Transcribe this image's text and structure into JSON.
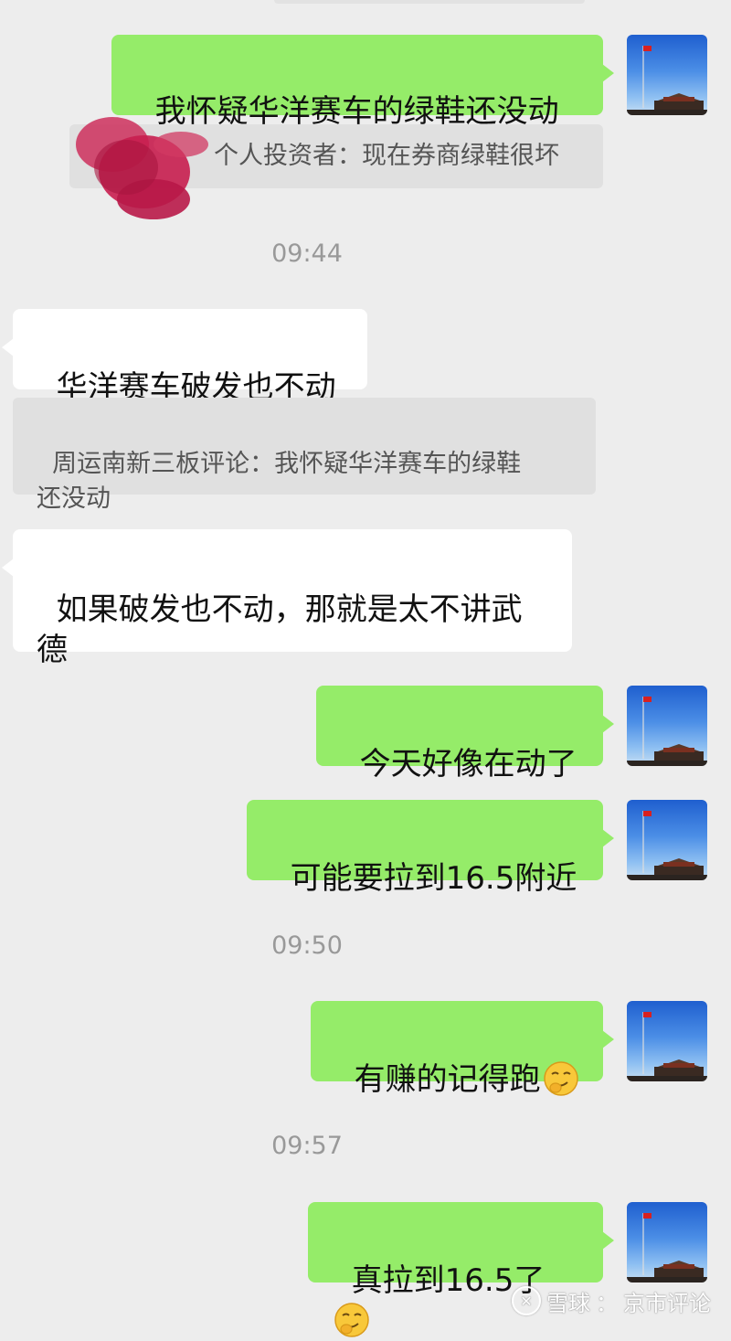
{
  "messages": [
    {
      "text": "我怀疑华洋赛车的绿鞋还没动",
      "quote": "个人投资者：现在券商绿鞋很坏"
    },
    {
      "time": "09:44"
    },
    {
      "text": "华洋赛车破发也不动",
      "quote": "周运南新三板评论：我怀疑华洋赛车的绿鞋\n还没动"
    },
    {
      "text": "如果破发也不动，那就是太不讲武\n德"
    },
    {
      "text": "今天好像在动了"
    },
    {
      "text": "可能要拉到16.5附近"
    },
    {
      "time": "09:50"
    },
    {
      "text": "有赚的记得跑"
    },
    {
      "time": "09:57"
    },
    {
      "text": "真拉到16.5了"
    }
  ],
  "watermark": {
    "brand": "雪球",
    "separator": "：",
    "author": "京市评论"
  },
  "icons": [
    "avatar-flag-tiananmen-icon",
    "smirk-emoji-icon",
    "redaction-scribble-icon",
    "xueqiu-logo-icon"
  ],
  "colors": {
    "outgoing_bubble": "#95ec69",
    "incoming_bubble": "#ffffff",
    "background": "#ededed",
    "quote_background": "#e0e0e0",
    "timestamp": "#999999"
  }
}
